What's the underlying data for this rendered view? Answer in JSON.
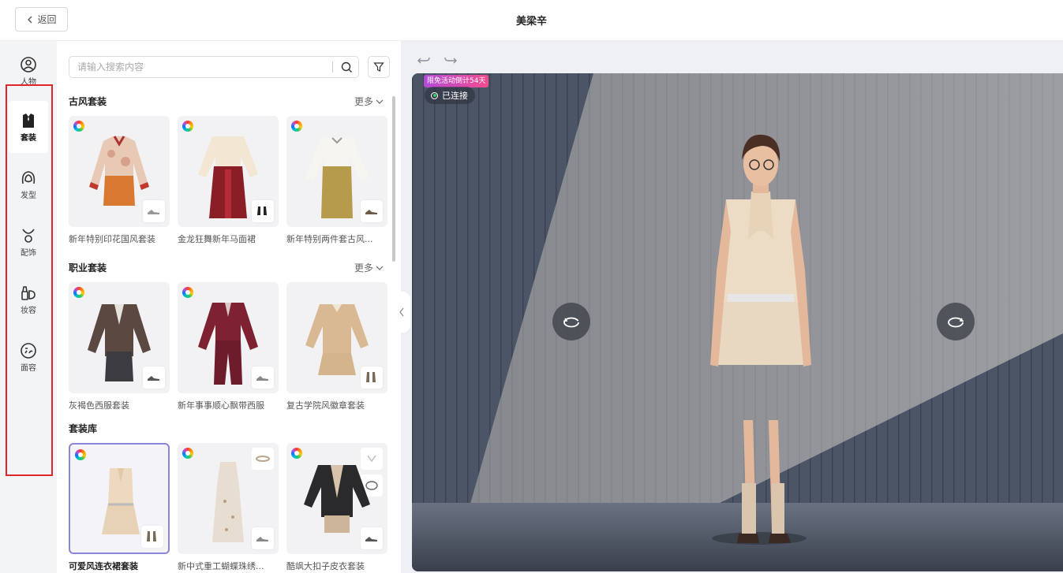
{
  "header": {
    "back_label": "返回",
    "title": "美梁辛"
  },
  "sidebar": {
    "items": [
      {
        "label": "人物",
        "icon": "person-icon"
      },
      {
        "label": "套装",
        "icon": "outfit-icon",
        "active": true
      },
      {
        "label": "发型",
        "icon": "hair-icon"
      },
      {
        "label": "配饰",
        "icon": "necklace-icon"
      },
      {
        "label": "妆容",
        "icon": "makeup-icon"
      },
      {
        "label": "面容",
        "icon": "face-icon"
      }
    ],
    "highlight_color": "#e0262b"
  },
  "search": {
    "placeholder": "请输入搜索内容",
    "value": ""
  },
  "sections": [
    {
      "title": "古风套装",
      "more_label": "更多",
      "items": [
        {
          "name": "新年特别印花国风套装"
        },
        {
          "name": "金龙狂舞新年马面裙"
        },
        {
          "name": "新年特别两件套古风..."
        }
      ]
    },
    {
      "title": "职业套装",
      "more_label": "更多",
      "items": [
        {
          "name": "灰褐色西服套装"
        },
        {
          "name": "新年事事顺心飘带西服"
        },
        {
          "name": "复古学院风徽章套装"
        }
      ]
    },
    {
      "title": "套装库",
      "items": [
        {
          "name": "可爱风连衣裙套装",
          "selected": true
        },
        {
          "name": "新中式重工蝴蝶珠绣..."
        },
        {
          "name": "酷飒大扣子皮衣套装"
        }
      ]
    }
  ],
  "preview": {
    "promo_badge": "限免活动倒计54天",
    "connection_status": "已连接",
    "accent_color": "#8a86d8"
  }
}
